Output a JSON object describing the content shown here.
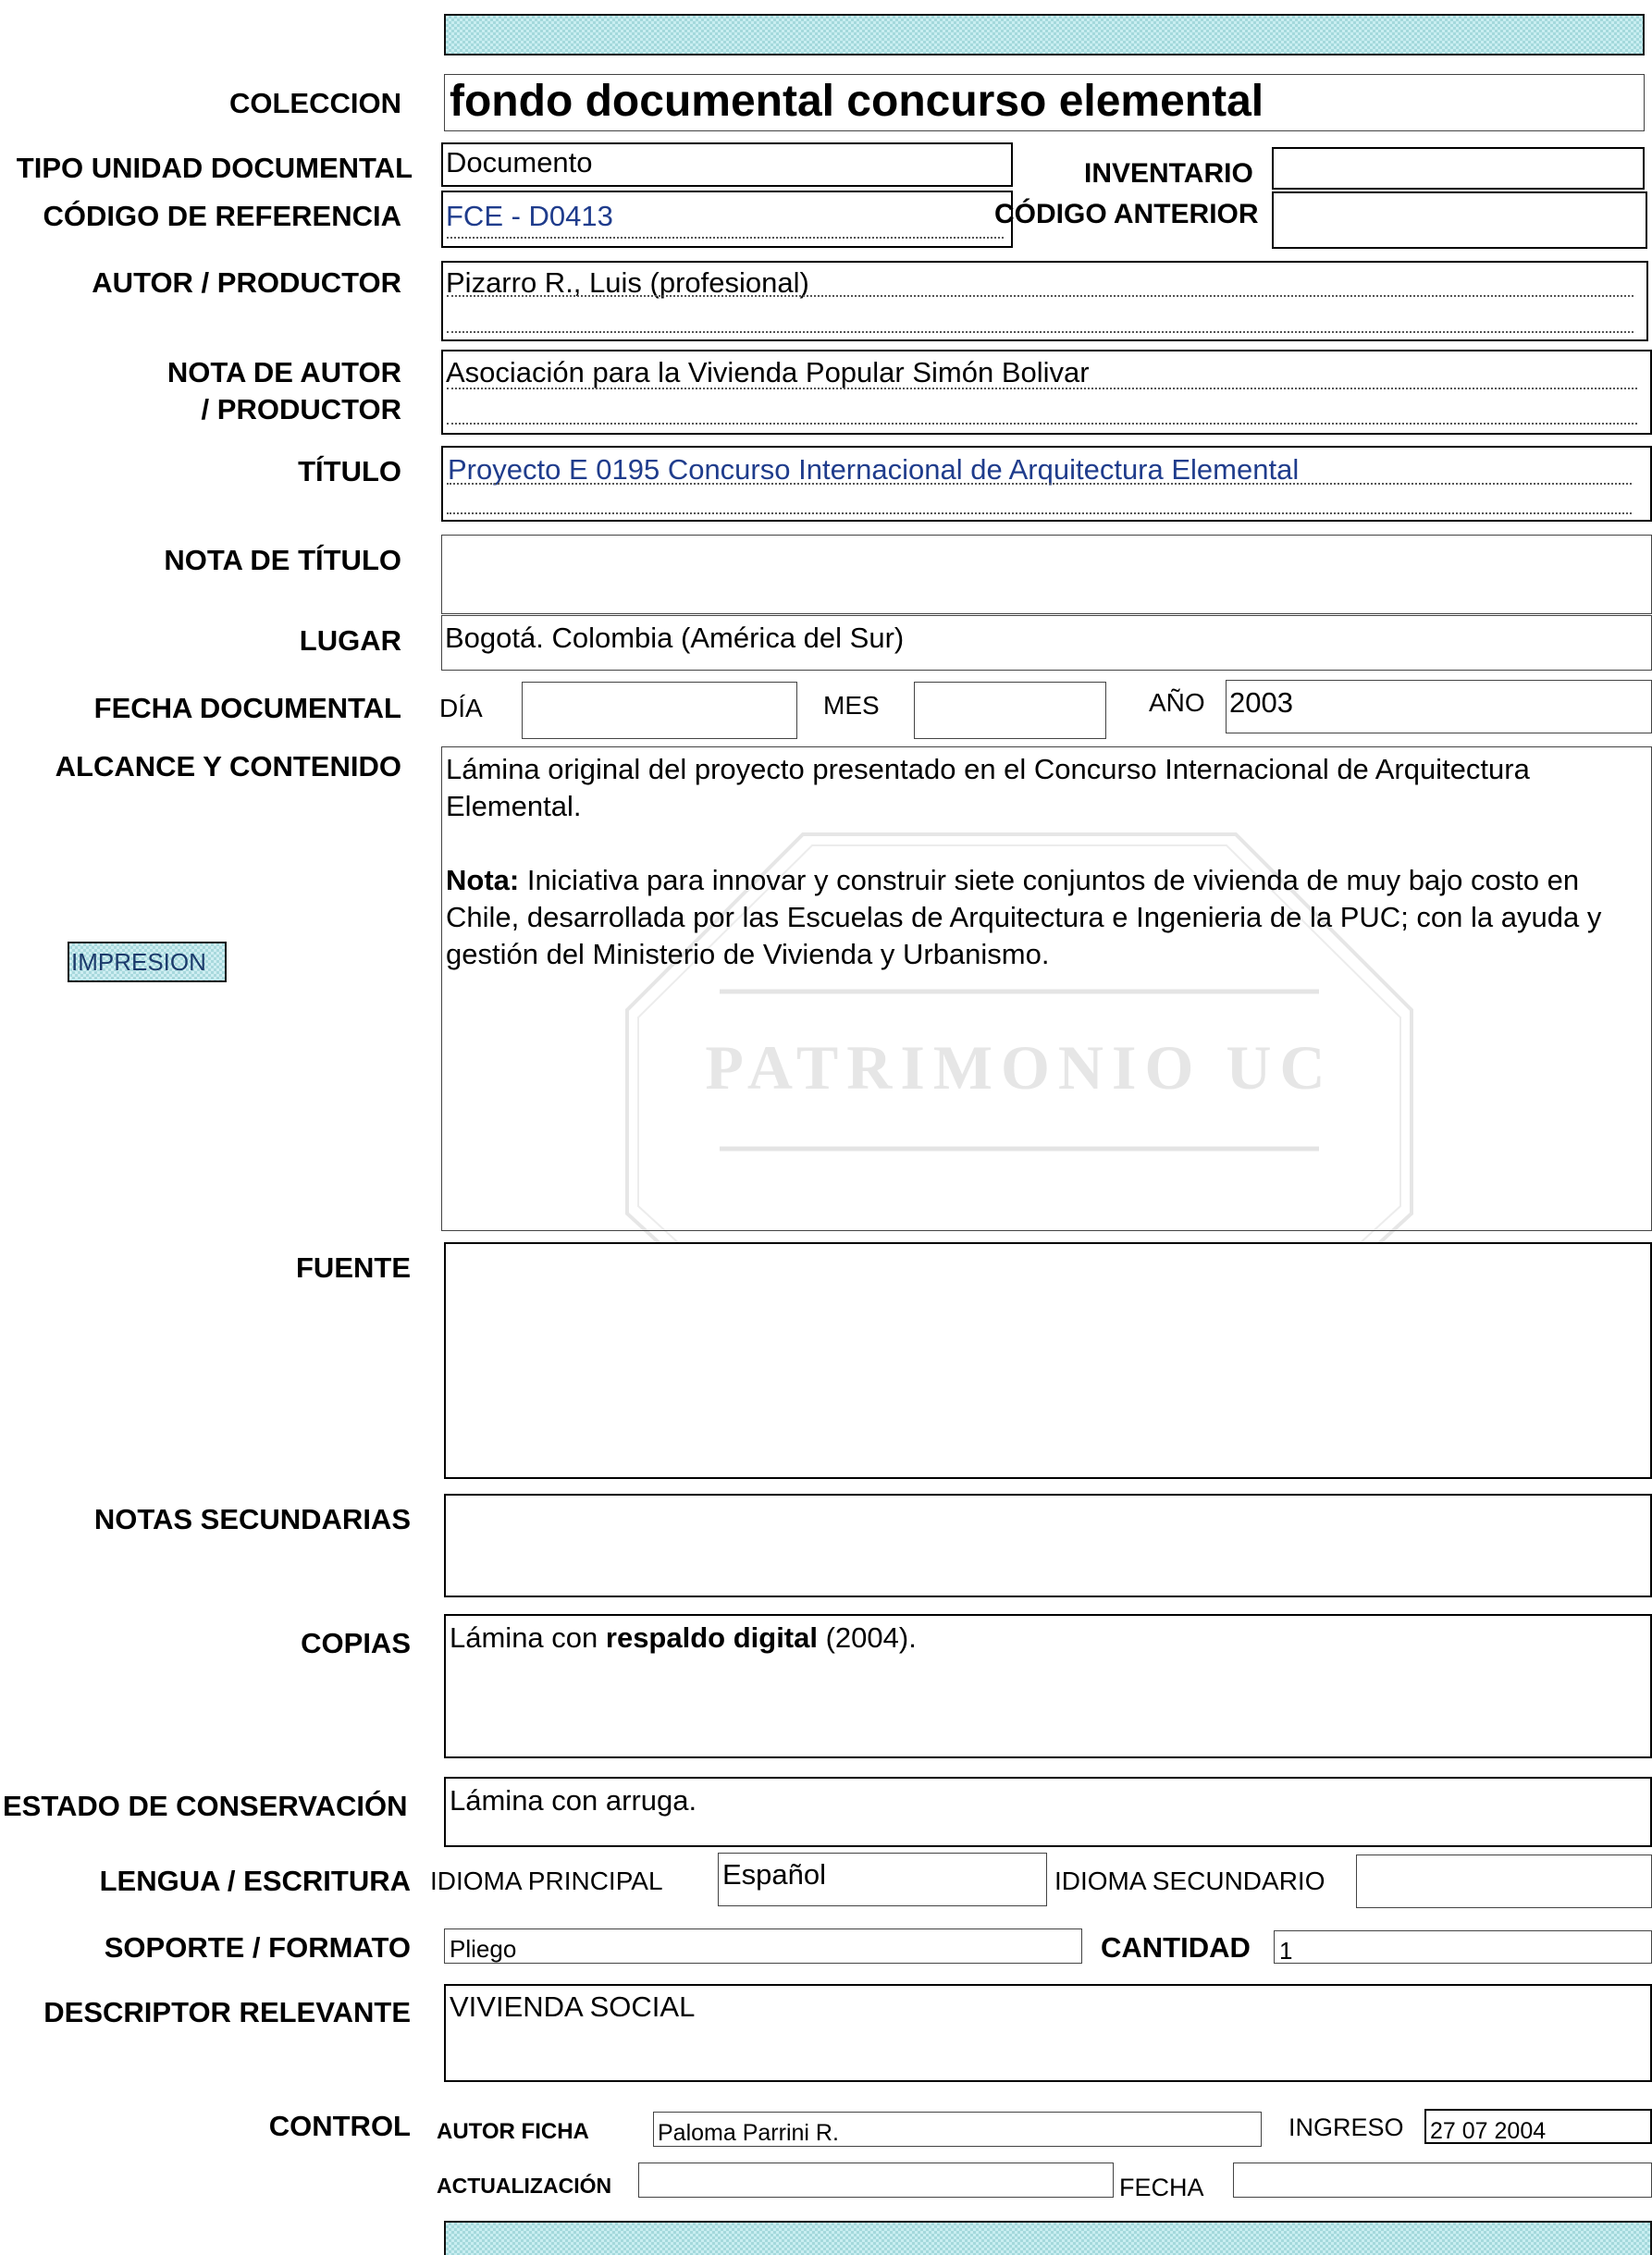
{
  "coleccion": {
    "label": "COLECCION",
    "value": "fondo documental concurso elemental"
  },
  "tipo_unidad": {
    "label": "TIPO UNIDAD DOCUMENTAL",
    "value": "Documento"
  },
  "inventario": {
    "label": "INVENTARIO",
    "value": ""
  },
  "codigo_referencia": {
    "label": "CÓDIGO DE REFERENCIA",
    "value": "FCE - D0413"
  },
  "codigo_anterior": {
    "label": "CÓDIGO ANTERIOR",
    "value": ""
  },
  "autor": {
    "label": "AUTOR / PRODUCTOR",
    "value": "Pizarro R., Luis (profesional)"
  },
  "nota_autor": {
    "label_1": "NOTA DE AUTOR",
    "label_2": "/ PRODUCTOR",
    "value": "Asociación para la Vivienda Popular Simón Bolivar"
  },
  "titulo": {
    "label": "TÍTULO",
    "value": "Proyecto E 0195 Concurso Internacional de Arquitectura Elemental"
  },
  "nota_titulo": {
    "label": "NOTA DE TÍTULO",
    "value": ""
  },
  "lugar": {
    "label": "LUGAR",
    "value": "Bogotá. Colombia (América del Sur)"
  },
  "fecha": {
    "label": "FECHA DOCUMENTAL",
    "dia_label": "DÍA",
    "dia": "",
    "mes_label": "MES",
    "mes": "",
    "anio_label": "AÑO",
    "anio": "2003"
  },
  "alcance": {
    "label": "ALCANCE Y CONTENIDO",
    "paragraph1": "Lámina original del proyecto presentado en el Concurso Internacional de Arquitectura Elemental.",
    "nota_label": "Nota:",
    "nota_text": " Iniciativa para innovar y construir siete conjuntos de vivienda de muy bajo costo en Chile, desarrollada por las Escuelas de Arquitectura e Ingenieria de la PUC; con la ayuda y gestión del Ministerio de Vivienda y Urbanismo."
  },
  "impresion_button": "IMPRESION",
  "watermark": "PATRIMONIO UC",
  "fuente": {
    "label": "FUENTE",
    "value": ""
  },
  "notas_secundarias": {
    "label": "NOTAS SECUNDARIAS",
    "value": ""
  },
  "copias": {
    "label": "COPIAS",
    "prefix": "Lámina con ",
    "bold": "respaldo digital",
    "suffix": " (2004)."
  },
  "estado": {
    "label": "ESTADO DE CONSERVACIÓN",
    "value": "Lámina con arruga."
  },
  "lengua": {
    "label": "LENGUA / ESCRITURA",
    "principal_label": "IDIOMA PRINCIPAL",
    "principal": "Español",
    "secundario_label": "IDIOMA SECUNDARIO",
    "secundario": ""
  },
  "soporte": {
    "label": "SOPORTE / FORMATO",
    "value": "Pliego",
    "cantidad_label": "CANTIDAD",
    "cantidad": "1"
  },
  "descriptor": {
    "label": "DESCRIPTOR RELEVANTE",
    "value": "VIVIENDA SOCIAL"
  },
  "control": {
    "label": "CONTROL",
    "autor_ficha_label": "AUTOR FICHA",
    "autor_ficha": "Paloma Parrini R.",
    "ingreso_label": "INGRESO",
    "ingreso": "27 07 2004",
    "actualizacion_label": "ACTUALIZACIÓN",
    "actualizacion": "",
    "fecha_label": "FECHA",
    "fecha": ""
  }
}
